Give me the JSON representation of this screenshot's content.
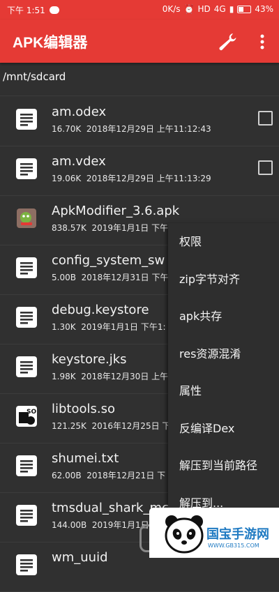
{
  "status_bar": {
    "time": "下午 1:51",
    "speed": "0K/s",
    "hd": "HD",
    "signal": "4G",
    "battery": "43%",
    "battery_level": 0.43
  },
  "app": {
    "title": "APK编辑器"
  },
  "toolbar": {
    "wrench_icon": "wrench-icon",
    "more_icon": "more-vert-icon"
  },
  "path": "/mnt/sdcard",
  "files": [
    {
      "name": "am.odex",
      "size": "16.70K",
      "date": "2018年12月29日 上午11:12:43",
      "icon": "doc-icon",
      "checkbox": true
    },
    {
      "name": "am.vdex",
      "size": "19.06K",
      "date": "2018年12月29日 上午11:13:29",
      "icon": "doc-icon",
      "checkbox": true
    },
    {
      "name": "ApkModifier_3.6.apk",
      "size": "838.57K",
      "date": "2019年1月1日 下午",
      "icon": "apk-icon",
      "checkbox": false
    },
    {
      "name": "config_system_sw",
      "size": "5.00B",
      "date": "2018年12月31日 下午",
      "icon": "doc-icon",
      "checkbox": false
    },
    {
      "name": "debug.keystore",
      "size": "1.30K",
      "date": "2019年1月1日 下午1:",
      "icon": "doc-icon",
      "checkbox": false
    },
    {
      "name": "keystore.jks",
      "size": "1.98K",
      "date": "2018年12月30日 上午",
      "icon": "doc-icon",
      "checkbox": false
    },
    {
      "name": "libtools.so",
      "size": "121.25K",
      "date": "2016年12月25日 下",
      "icon": "so-icon",
      "checkbox": false
    },
    {
      "name": "shumei.txt",
      "size": "62.00B",
      "date": "2018年12月21日 下",
      "icon": "doc-icon",
      "checkbox": false
    },
    {
      "name": "tmsdual_shark_mc",
      "size": "144.00B",
      "date": "2019年1月1日 下午",
      "icon": "doc-icon",
      "checkbox": false
    },
    {
      "name": "wm_uuid",
      "size": "",
      "date": "",
      "icon": "doc-icon",
      "checkbox": false
    }
  ],
  "context_menu": [
    "权限",
    "zip字节对齐",
    "apk共存",
    "res资源混淆",
    "属性",
    "反编译Dex",
    "解压到当前路径",
    "解压到..."
  ],
  "watermark": {
    "text": "国宝手游网",
    "url": "WWW.GB315.COM"
  }
}
